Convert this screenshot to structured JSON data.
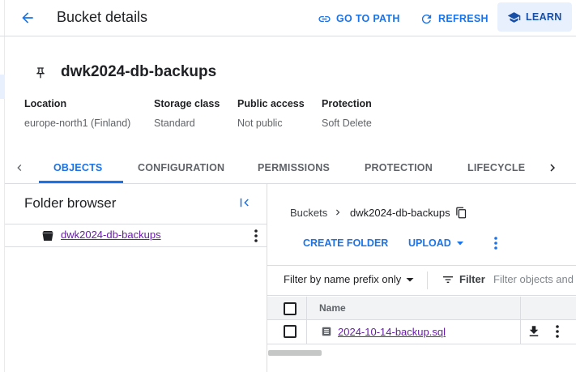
{
  "header": {
    "title": "Bucket details",
    "go_to_path": "GO TO PATH",
    "refresh": "REFRESH",
    "learn": "LEARN"
  },
  "bucket": {
    "name": "dwk2024-db-backups",
    "properties": [
      {
        "label": "Location",
        "value": "europe-north1 (Finland)"
      },
      {
        "label": "Storage class",
        "value": "Standard"
      },
      {
        "label": "Public access",
        "value": "Not public"
      },
      {
        "label": "Protection",
        "value": "Soft Delete"
      }
    ]
  },
  "tabs": {
    "items": [
      "OBJECTS",
      "CONFIGURATION",
      "PERMISSIONS",
      "PROTECTION",
      "LIFECYCLE"
    ],
    "active": "OBJECTS"
  },
  "folder_browser": {
    "title": "Folder browser",
    "root": "dwk2024-db-backups"
  },
  "objects": {
    "breadcrumb_root": "Buckets",
    "breadcrumb_current": "dwk2024-db-backups",
    "create_folder": "CREATE FOLDER",
    "upload": "UPLOAD",
    "filter_mode": "Filter by name prefix only",
    "filter_label": "Filter",
    "filter_placeholder": "Filter objects and folders",
    "column_name": "Name",
    "rows": [
      {
        "name": "2024-10-14-backup.sql"
      }
    ]
  },
  "colors": {
    "accent": "#1a73e8",
    "visited_link": "#681da8"
  }
}
